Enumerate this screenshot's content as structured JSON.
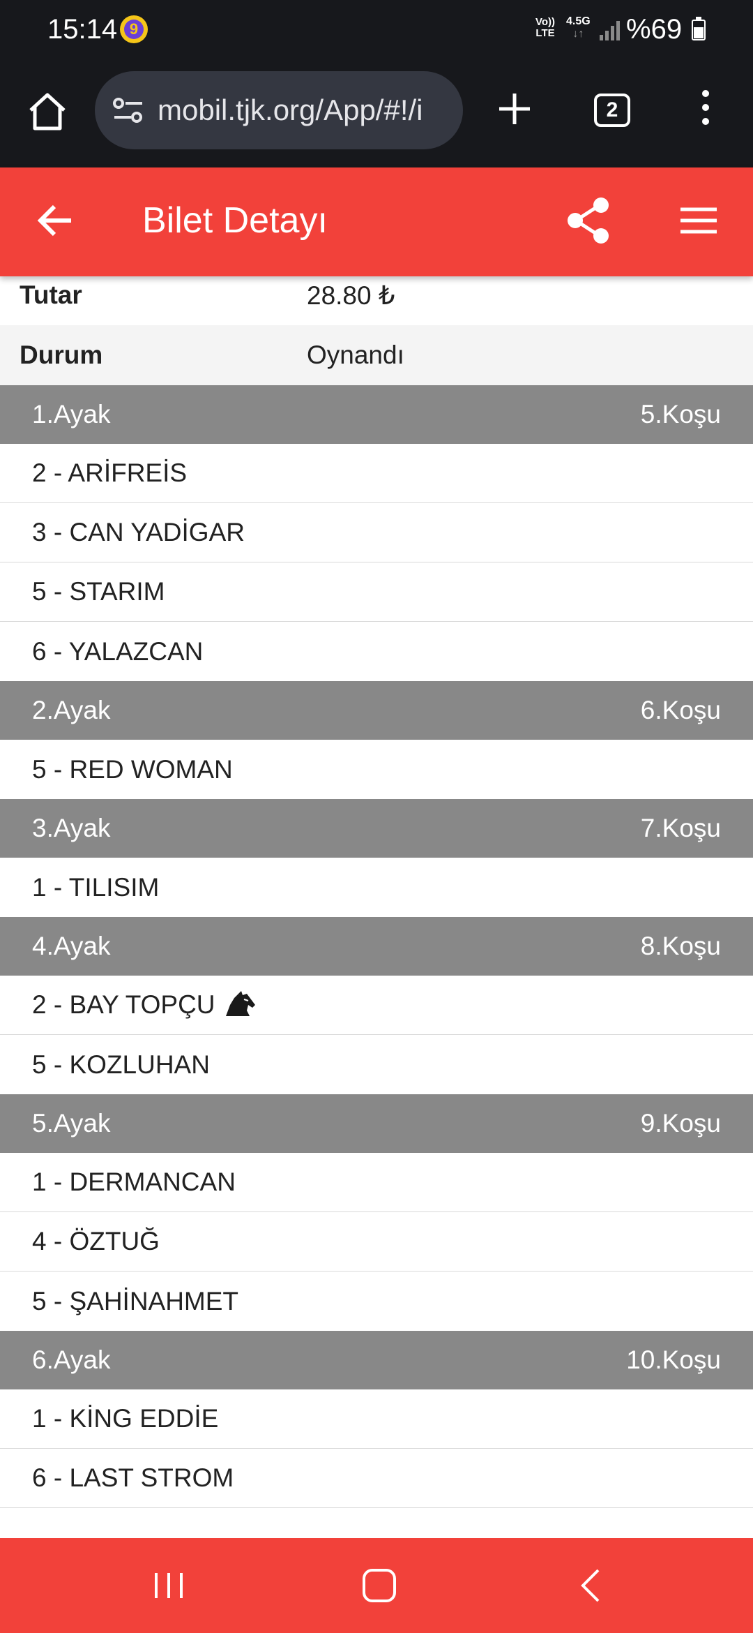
{
  "status_bar": {
    "time": "15:14",
    "app_icon_glyph": "9",
    "volte_line1": "Vo))",
    "volte_line2": "LTE",
    "network": "4.5G",
    "network_arrows": "↓↑",
    "battery_text": "%69",
    "icons": [
      "app-notification-icon",
      "volte-icon",
      "signal-icon",
      "battery-icon"
    ]
  },
  "browser": {
    "url": "mobil.tjk.org/App/#!/i",
    "tab_count": "2",
    "icons": [
      "home-icon",
      "site-settings-icon",
      "plus-icon",
      "tabs-icon",
      "more-vert-icon"
    ]
  },
  "header": {
    "title": "Bilet Detayı",
    "icons": [
      "arrow-back-icon",
      "share-icon",
      "hamburger-menu-icon"
    ]
  },
  "ticket_info": [
    {
      "label": "Tutar",
      "value": "28.80 ₺"
    },
    {
      "label": "Durum",
      "value": "Oynandı"
    }
  ],
  "legs": [
    {
      "leg": "1.Ayak",
      "race": "5.Koşu",
      "horses": [
        "2 - ARİFREİS",
        "3 - CAN YADİGAR",
        "5 - STARIM",
        "6 - YALAZCAN"
      ]
    },
    {
      "leg": "2.Ayak",
      "race": "6.Koşu",
      "horses": [
        "5 - RED WOMAN"
      ]
    },
    {
      "leg": "3.Ayak",
      "race": "7.Koşu",
      "horses": [
        "1 - TILISIM"
      ]
    },
    {
      "leg": "4.Ayak",
      "race": "8.Koşu",
      "horses": [
        "2 - BAY TOPÇU",
        "5 - KOZLUHAN"
      ]
    },
    {
      "leg": "5.Ayak",
      "race": "9.Koşu",
      "horses": [
        "1 - DERMANCAN",
        "4 - ÖZTUĞ",
        "5 - ŞAHİNAHMET"
      ]
    },
    {
      "leg": "6.Ayak",
      "race": "10.Koşu",
      "horses": [
        "1 - KİNG EDDİE",
        "6 - LAST STROM"
      ]
    }
  ],
  "horse_icon": {
    "row": "2 - BAY TOPÇU",
    "icon": "horse-head-icon"
  },
  "nav_bar": {
    "icons": [
      "recents-icon",
      "home-circle-icon",
      "back-chevron-icon"
    ]
  },
  "colors": {
    "header_red": "#f2413a",
    "leg_header_gray": "#888888",
    "status_bar_dark": "#17181c",
    "url_pill": "#343741"
  }
}
